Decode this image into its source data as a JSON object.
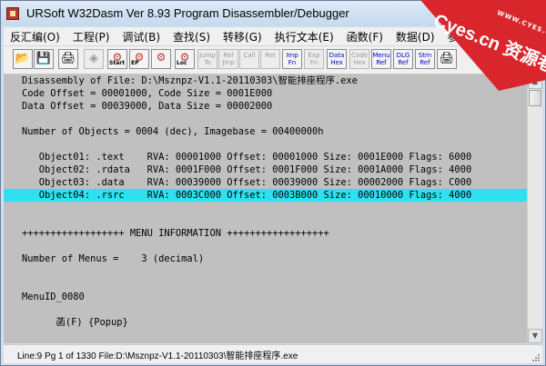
{
  "window": {
    "title": "URSoft W32Dasm Ver 8.93 Program Disassembler/Debugger",
    "buttons": {
      "minimize": "–",
      "maximize": "□",
      "close": "✕"
    }
  },
  "menu": [
    {
      "label": "反汇编(O)"
    },
    {
      "label": "工程(P)"
    },
    {
      "label": "调试(B)"
    },
    {
      "label": "查找(S)"
    },
    {
      "label": "转移(G)"
    },
    {
      "label": "执行文本(E)"
    },
    {
      "label": "函数(F)"
    },
    {
      "label": "数据(D)"
    },
    {
      "label": "参考"
    }
  ],
  "toolbar": [
    {
      "name": "open-file-icon",
      "label": "",
      "glyph": "📂",
      "state": "enabled"
    },
    {
      "name": "save-disassembly-icon",
      "label": "",
      "glyph": "💾",
      "state": "enabled"
    },
    {
      "name": "print-icon",
      "label": "",
      "glyph": "🖨",
      "state": "enabled"
    },
    {
      "name": "load-process-icon",
      "label": "",
      "glyph": "◈",
      "state": "disabled"
    },
    {
      "name": "step-start-icon",
      "label": "Start",
      "glyph": "⚙",
      "state": "enabled"
    },
    {
      "name": "entry-point-icon",
      "label": "EP",
      "glyph": "⚙",
      "state": "enabled"
    },
    {
      "name": "goto-code-icon",
      "label": "",
      "glyph": "⚙",
      "state": "enabled"
    },
    {
      "name": "code-location-icon",
      "label": "Loc",
      "glyph": "⚙",
      "state": "enabled"
    },
    {
      "name": "jump-to-icon",
      "label": "Jump To",
      "glyph": "",
      "state": "disabled"
    },
    {
      "name": "ref-jmp-icon",
      "label": "Ref Jmp",
      "glyph": "",
      "state": "disabled"
    },
    {
      "name": "call-icon",
      "label": "Call",
      "glyph": "",
      "state": "disabled"
    },
    {
      "name": "ret-icon",
      "label": "Ret",
      "glyph": "",
      "state": "disabled"
    },
    {
      "name": "imp-fn-icon",
      "label": "Imp Fn",
      "glyph": "",
      "state": "active"
    },
    {
      "name": "exp-fn-icon",
      "label": "Exp Fn",
      "glyph": "",
      "state": "disabled"
    },
    {
      "name": "data-hex-icon",
      "label": "Data Hex",
      "glyph": "",
      "state": "active"
    },
    {
      "name": "code-hex-icon",
      "label": "Code Hex",
      "glyph": "",
      "state": "disabled"
    },
    {
      "name": "menu-ref-icon",
      "label": "Menu Ref",
      "glyph": "",
      "state": "active"
    },
    {
      "name": "dlg-ref-icon",
      "label": "DLG Ref",
      "glyph": "",
      "state": "active"
    },
    {
      "name": "str-ref-icon",
      "label": "Strn Ref",
      "glyph": "",
      "state": "active"
    },
    {
      "name": "print-page-icon",
      "label": "",
      "glyph": "🖨",
      "state": "enabled"
    }
  ],
  "listing": {
    "lines": [
      {
        "text": "Disassembly of File: D:\\Msznpz-V1.1-20110303\\智能排座程序.exe",
        "highlight": false
      },
      {
        "text": "Code Offset = 00001000, Code Size = 0001E000",
        "highlight": false
      },
      {
        "text": "Data Offset = 00039000, Data Size = 00002000",
        "highlight": false
      },
      {
        "text": "",
        "highlight": false
      },
      {
        "text": "Number of Objects = 0004 (dec), Imagebase = 00400000h",
        "highlight": false
      },
      {
        "text": "",
        "highlight": false
      },
      {
        "text": "   Object01: .text    RVA: 00001000 Offset: 00001000 Size: 0001E000 Flags: 6000",
        "highlight": false
      },
      {
        "text": "   Object02: .rdata   RVA: 0001F000 Offset: 0001F000 Size: 0001A000 Flags: 4000",
        "highlight": false
      },
      {
        "text": "   Object03: .data    RVA: 00039000 Offset: 00039000 Size: 00002000 Flags: C000",
        "highlight": false
      },
      {
        "text": "   Object04: .rsrc    RVA: 0003C000 Offset: 0003B000 Size: 00010000 Flags: 4000",
        "highlight": true
      },
      {
        "text": "",
        "highlight": false
      },
      {
        "text": "",
        "highlight": false
      },
      {
        "text": "++++++++++++++++++ MENU INFORMATION ++++++++++++++++++",
        "highlight": false
      },
      {
        "text": "",
        "highlight": false
      },
      {
        "text": "Number of Menus =    3 (decimal)",
        "highlight": false
      },
      {
        "text": "",
        "highlight": false
      },
      {
        "text": "",
        "highlight": false
      },
      {
        "text": "MenuID_0080",
        "highlight": false
      },
      {
        "text": "",
        "highlight": false
      },
      {
        "text": "      菡(F) {Popup}",
        "highlight": false
      }
    ]
  },
  "statusbar": {
    "text": "Line:9 Pg 1 of 1330  File:D:\\Msznpz-V1.1-20110303\\智能排座程序.exe"
  },
  "watermark": {
    "line1": "Cyes.cn 资源巷",
    "line2": "WWW.CYES.CN"
  },
  "colors": {
    "listing_bg": "#c0c0c0",
    "highlight": "#2fe0f0",
    "watermark": "#d9262c"
  }
}
